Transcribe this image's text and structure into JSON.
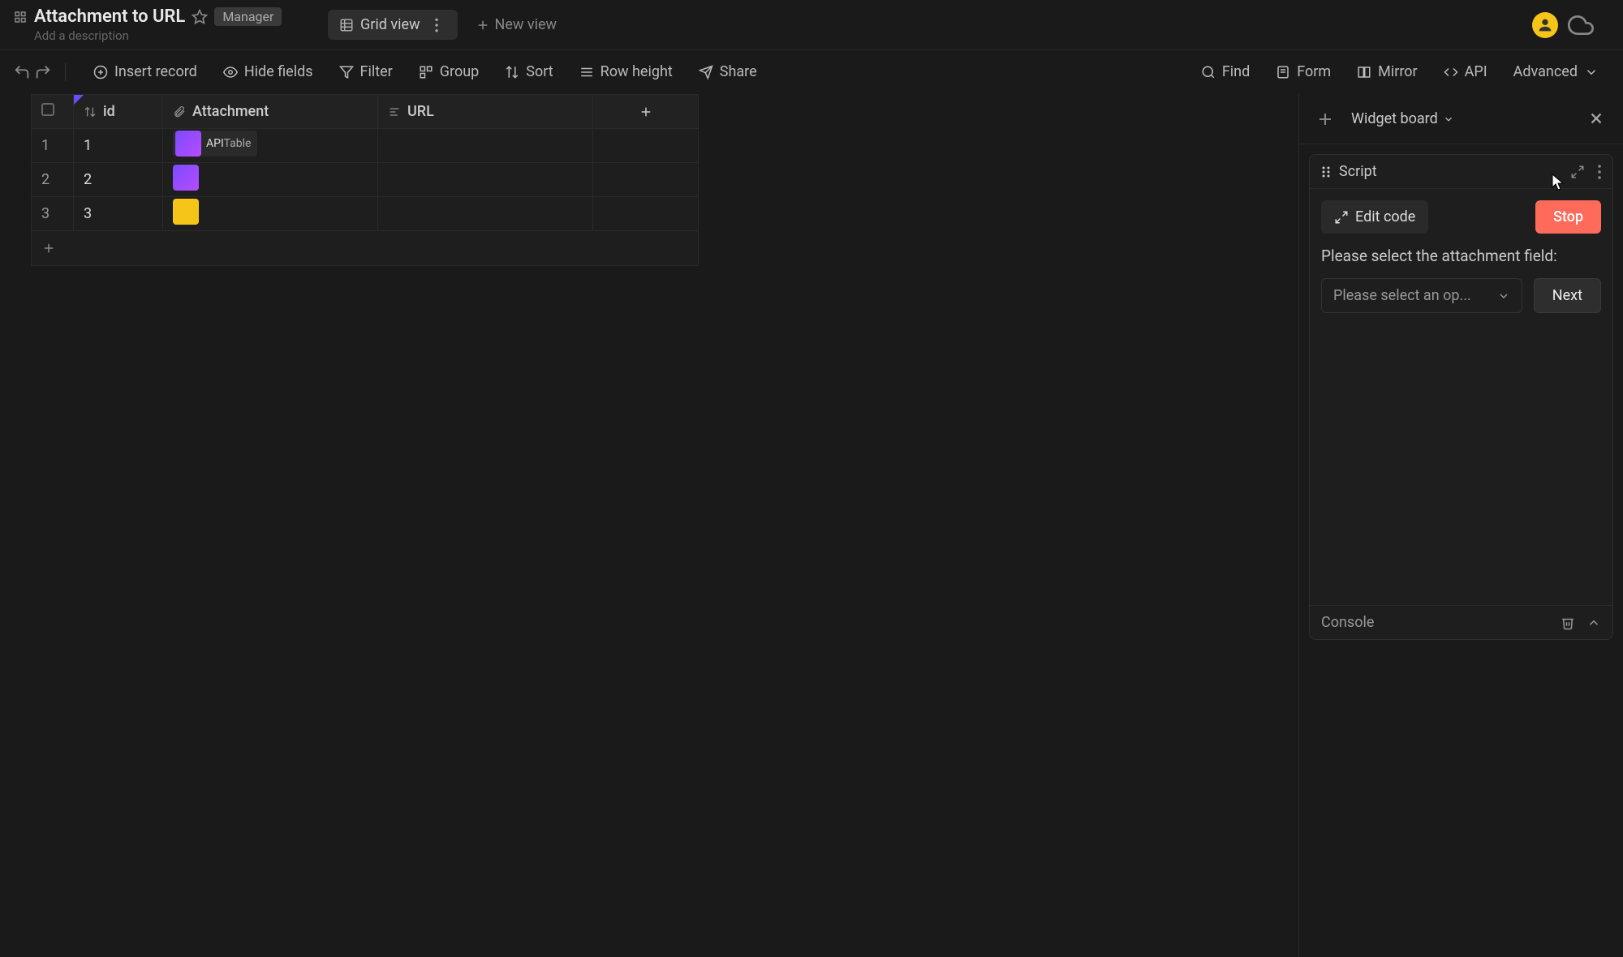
{
  "header": {
    "title": "Attachment to URL",
    "badge": "Manager",
    "description_placeholder": "Add a description"
  },
  "views": {
    "active_tab": "Grid view",
    "new_view": "New view"
  },
  "toolbar": {
    "insert_record": "Insert record",
    "hide_fields": "Hide fields",
    "filter": "Filter",
    "group": "Group",
    "sort": "Sort",
    "row_height": "Row height",
    "share": "Share",
    "find": "Find",
    "form": "Form",
    "mirror": "Mirror",
    "api": "API",
    "advanced": "Advanced"
  },
  "grid": {
    "columns": {
      "id": "id",
      "attachment": "Attachment",
      "url": "URL"
    },
    "rows": [
      {
        "num": "1",
        "id": "1",
        "attachment_label": "APITable"
      },
      {
        "num": "2",
        "id": "2",
        "attachment_label": ""
      },
      {
        "num": "3",
        "id": "3",
        "attachment_label": ""
      }
    ]
  },
  "right_panel": {
    "board_label": "Widget board",
    "widget": {
      "title": "Script",
      "edit_code": "Edit code",
      "stop": "Stop",
      "prompt": "Please select the attachment field:",
      "select_placeholder": "Please select an op...",
      "next": "Next",
      "console": "Console"
    }
  }
}
